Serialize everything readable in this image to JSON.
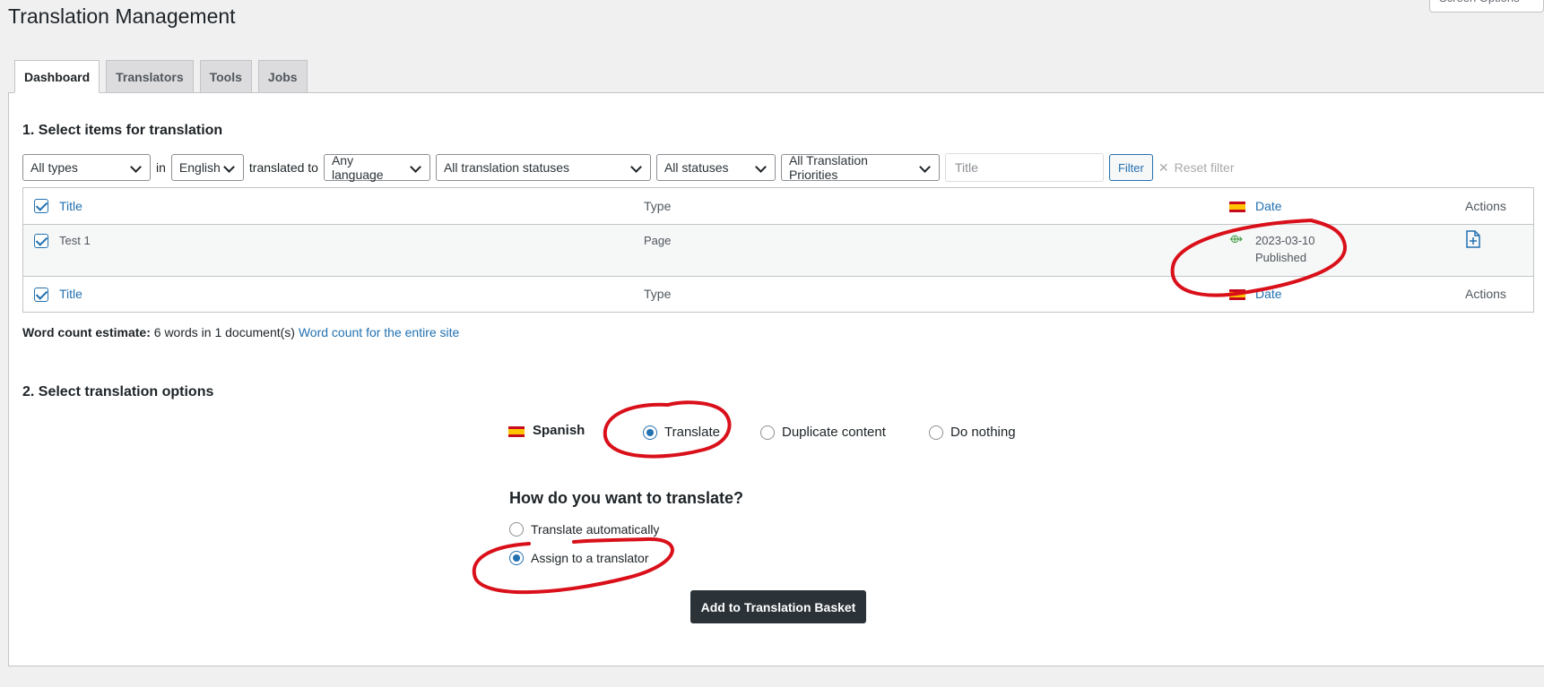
{
  "page": {
    "title": "Translation Management",
    "screen_options": "Screen Options"
  },
  "tabs": [
    {
      "label": "Dashboard",
      "active": true
    },
    {
      "label": "Translators"
    },
    {
      "label": "Tools"
    },
    {
      "label": "Jobs"
    }
  ],
  "section1": {
    "heading": "1. Select items for translation"
  },
  "filters": {
    "type": "All types",
    "in_label": "in",
    "source_language": "English",
    "translated_to_label": "translated to",
    "target_language": "Any language",
    "translation_status": "All translation statuses",
    "status": "All statuses",
    "priority": "All Translation Priorities",
    "title_placeholder": "Title",
    "filter_button": "Filter",
    "reset": "Reset filter"
  },
  "table": {
    "columns": {
      "title": "Title",
      "type": "Type",
      "date": "Date",
      "actions": "Actions"
    },
    "rows": [
      {
        "title": "Test 1",
        "type": "Page",
        "date": "2023-03-10",
        "status": "Published"
      }
    ]
  },
  "word_count": {
    "label": "Word count estimate:",
    "value": "6 words in 1 document(s)",
    "link": "Word count for the entire site"
  },
  "section2": {
    "heading": "2. Select translation options"
  },
  "language_options": {
    "language": "Spanish",
    "translate": "Translate",
    "duplicate": "Duplicate content",
    "nothing": "Do nothing",
    "selected": "Translate"
  },
  "how": {
    "heading": "How do you want to translate?",
    "auto": "Translate automatically",
    "assign": "Assign to a translator",
    "selected": "Assign to a translator"
  },
  "add_button": "Add to Translation Basket",
  "colors": {
    "accent": "#2271b1",
    "annotation": "#d9101a",
    "dark_button": "#2c3338"
  }
}
